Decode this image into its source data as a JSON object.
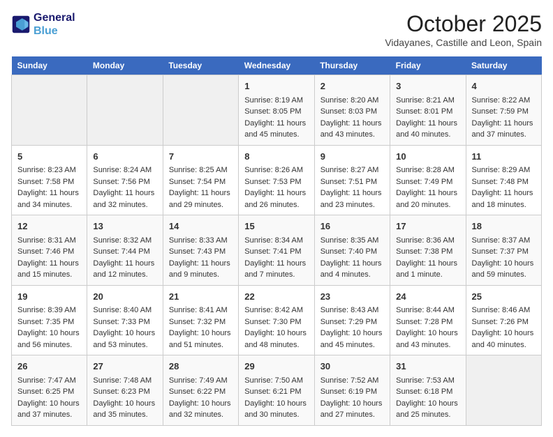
{
  "header": {
    "logo_line1": "General",
    "logo_line2": "Blue",
    "month_title": "October 2025",
    "location": "Vidayanes, Castille and Leon, Spain"
  },
  "weekdays": [
    "Sunday",
    "Monday",
    "Tuesday",
    "Wednesday",
    "Thursday",
    "Friday",
    "Saturday"
  ],
  "weeks": [
    [
      {
        "day": "",
        "info": ""
      },
      {
        "day": "",
        "info": ""
      },
      {
        "day": "",
        "info": ""
      },
      {
        "day": "1",
        "info": "Sunrise: 8:19 AM\nSunset: 8:05 PM\nDaylight: 11 hours and 45 minutes."
      },
      {
        "day": "2",
        "info": "Sunrise: 8:20 AM\nSunset: 8:03 PM\nDaylight: 11 hours and 43 minutes."
      },
      {
        "day": "3",
        "info": "Sunrise: 8:21 AM\nSunset: 8:01 PM\nDaylight: 11 hours and 40 minutes."
      },
      {
        "day": "4",
        "info": "Sunrise: 8:22 AM\nSunset: 7:59 PM\nDaylight: 11 hours and 37 minutes."
      }
    ],
    [
      {
        "day": "5",
        "info": "Sunrise: 8:23 AM\nSunset: 7:58 PM\nDaylight: 11 hours and 34 minutes."
      },
      {
        "day": "6",
        "info": "Sunrise: 8:24 AM\nSunset: 7:56 PM\nDaylight: 11 hours and 32 minutes."
      },
      {
        "day": "7",
        "info": "Sunrise: 8:25 AM\nSunset: 7:54 PM\nDaylight: 11 hours and 29 minutes."
      },
      {
        "day": "8",
        "info": "Sunrise: 8:26 AM\nSunset: 7:53 PM\nDaylight: 11 hours and 26 minutes."
      },
      {
        "day": "9",
        "info": "Sunrise: 8:27 AM\nSunset: 7:51 PM\nDaylight: 11 hours and 23 minutes."
      },
      {
        "day": "10",
        "info": "Sunrise: 8:28 AM\nSunset: 7:49 PM\nDaylight: 11 hours and 20 minutes."
      },
      {
        "day": "11",
        "info": "Sunrise: 8:29 AM\nSunset: 7:48 PM\nDaylight: 11 hours and 18 minutes."
      }
    ],
    [
      {
        "day": "12",
        "info": "Sunrise: 8:31 AM\nSunset: 7:46 PM\nDaylight: 11 hours and 15 minutes."
      },
      {
        "day": "13",
        "info": "Sunrise: 8:32 AM\nSunset: 7:44 PM\nDaylight: 11 hours and 12 minutes."
      },
      {
        "day": "14",
        "info": "Sunrise: 8:33 AM\nSunset: 7:43 PM\nDaylight: 11 hours and 9 minutes."
      },
      {
        "day": "15",
        "info": "Sunrise: 8:34 AM\nSunset: 7:41 PM\nDaylight: 11 hours and 7 minutes."
      },
      {
        "day": "16",
        "info": "Sunrise: 8:35 AM\nSunset: 7:40 PM\nDaylight: 11 hours and 4 minutes."
      },
      {
        "day": "17",
        "info": "Sunrise: 8:36 AM\nSunset: 7:38 PM\nDaylight: 11 hours and 1 minute."
      },
      {
        "day": "18",
        "info": "Sunrise: 8:37 AM\nSunset: 7:37 PM\nDaylight: 10 hours and 59 minutes."
      }
    ],
    [
      {
        "day": "19",
        "info": "Sunrise: 8:39 AM\nSunset: 7:35 PM\nDaylight: 10 hours and 56 minutes."
      },
      {
        "day": "20",
        "info": "Sunrise: 8:40 AM\nSunset: 7:33 PM\nDaylight: 10 hours and 53 minutes."
      },
      {
        "day": "21",
        "info": "Sunrise: 8:41 AM\nSunset: 7:32 PM\nDaylight: 10 hours and 51 minutes."
      },
      {
        "day": "22",
        "info": "Sunrise: 8:42 AM\nSunset: 7:30 PM\nDaylight: 10 hours and 48 minutes."
      },
      {
        "day": "23",
        "info": "Sunrise: 8:43 AM\nSunset: 7:29 PM\nDaylight: 10 hours and 45 minutes."
      },
      {
        "day": "24",
        "info": "Sunrise: 8:44 AM\nSunset: 7:28 PM\nDaylight: 10 hours and 43 minutes."
      },
      {
        "day": "25",
        "info": "Sunrise: 8:46 AM\nSunset: 7:26 PM\nDaylight: 10 hours and 40 minutes."
      }
    ],
    [
      {
        "day": "26",
        "info": "Sunrise: 7:47 AM\nSunset: 6:25 PM\nDaylight: 10 hours and 37 minutes."
      },
      {
        "day": "27",
        "info": "Sunrise: 7:48 AM\nSunset: 6:23 PM\nDaylight: 10 hours and 35 minutes."
      },
      {
        "day": "28",
        "info": "Sunrise: 7:49 AM\nSunset: 6:22 PM\nDaylight: 10 hours and 32 minutes."
      },
      {
        "day": "29",
        "info": "Sunrise: 7:50 AM\nSunset: 6:21 PM\nDaylight: 10 hours and 30 minutes."
      },
      {
        "day": "30",
        "info": "Sunrise: 7:52 AM\nSunset: 6:19 PM\nDaylight: 10 hours and 27 minutes."
      },
      {
        "day": "31",
        "info": "Sunrise: 7:53 AM\nSunset: 6:18 PM\nDaylight: 10 hours and 25 minutes."
      },
      {
        "day": "",
        "info": ""
      }
    ]
  ]
}
